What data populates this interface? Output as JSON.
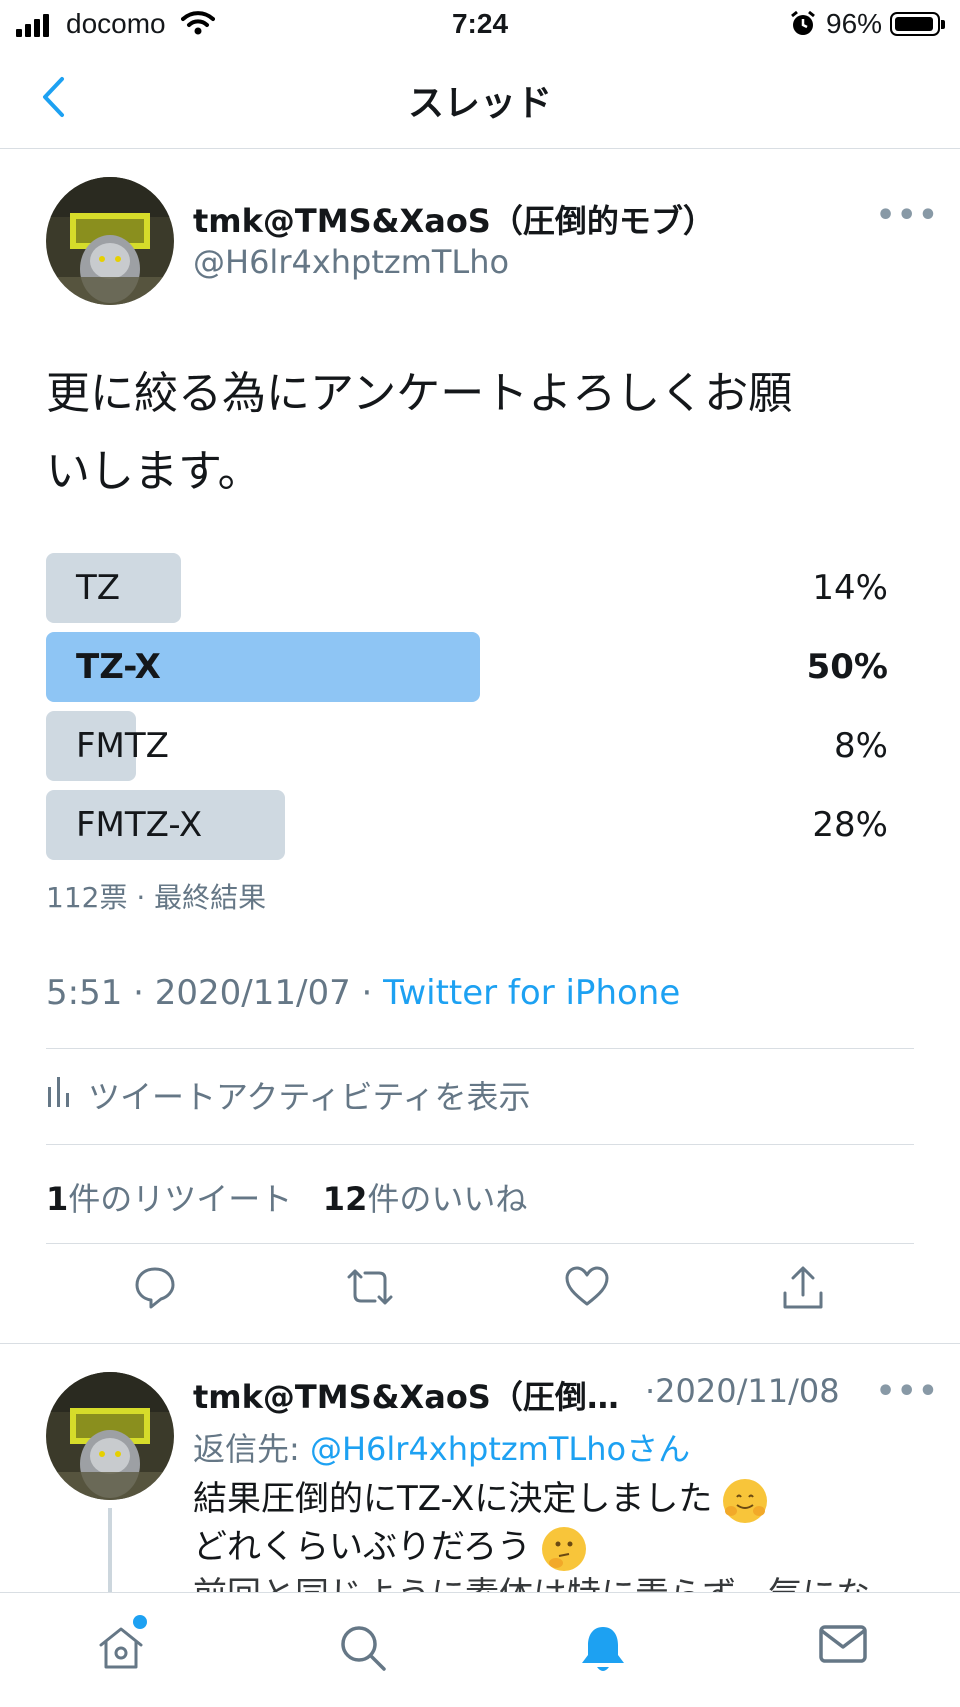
{
  "status_bar": {
    "carrier": "docomo",
    "time": "7:24",
    "battery_percent": "96%",
    "battery_level": 0.96,
    "signal_bars": 4
  },
  "nav": {
    "title": "スレッド",
    "back_icon": "chevron-left-icon"
  },
  "tweet": {
    "display_name": "tmk@TMS&XaoS（圧倒的モブ）",
    "handle": "@H6lr4xhptzmTLho",
    "text_line1": "更に絞る為にアンケートよろしくお願",
    "text_line2": "いします。",
    "poll": {
      "options": [
        {
          "label": "TZ",
          "percent": "14%",
          "value": 14,
          "winner": false
        },
        {
          "label": "TZ-X",
          "percent": "50%",
          "value": 50,
          "winner": true
        },
        {
          "label": "FMTZ",
          "percent": "8%",
          "value": 8,
          "winner": false
        },
        {
          "label": "FMTZ-X",
          "percent": "28%",
          "value": 28,
          "winner": false
        }
      ],
      "meta": "112票 · 最終結果"
    },
    "timestamp": "5:51 · 2020/11/07 · ",
    "source": "Twitter for iPhone",
    "activity_label": "ツイートアクティビティを表示",
    "retweets_count": "1",
    "retweets_label": "件のリツイート",
    "likes_count": "12",
    "likes_label": "件のいいね"
  },
  "reply": {
    "display_name": "tmk@TMS&XaoS（圧倒…",
    "date": "·2020/11/08",
    "reply_to_prefix": "返信先: ",
    "reply_to_handle": "@H6lr4xhptzmTLhoさん",
    "line1": "結果圧倒的にTZ-Xに決定しました",
    "line2": "どれくらいぶりだろう",
    "line3": "前回と同じように素体は特に弄らず、気にな"
  },
  "colors": {
    "accent": "#1da1f2",
    "winner_bar": "#8ec5f4",
    "loser_bar": "#cfd9e1",
    "secondary_text": "#657786"
  },
  "tabbar": {
    "items": [
      "home-icon",
      "search-icon",
      "notifications-icon",
      "messages-icon"
    ],
    "active": "notifications-icon"
  }
}
